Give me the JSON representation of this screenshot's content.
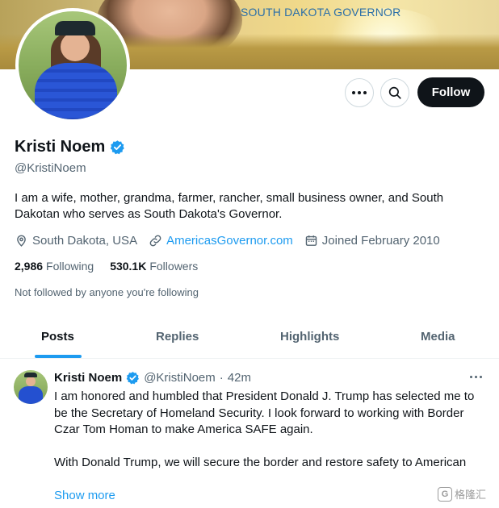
{
  "banner": {
    "title": "SOUTH DAKOTA GOVERNOR"
  },
  "profile": {
    "name": "Kristi Noem",
    "handle": "@KristiNoem",
    "bio": "I am a wife, mother, grandma, farmer, rancher, small business owner, and South Dakotan who serves as South Dakota's Governor.",
    "location": "South Dakota, USA",
    "website": "AmericasGovernor.com",
    "joined": "Joined February 2010",
    "following_count": "2,986",
    "following_label": "Following",
    "followers_count": "530.1K",
    "followers_label": "Followers",
    "not_followed": "Not followed by anyone you're following"
  },
  "actions": {
    "follow_label": "Follow"
  },
  "tabs": [
    {
      "label": "Posts",
      "active": true
    },
    {
      "label": "Replies",
      "active": false
    },
    {
      "label": "Highlights",
      "active": false
    },
    {
      "label": "Media",
      "active": false
    }
  ],
  "tweet": {
    "name": "Kristi Noem",
    "handle": "@KristiNoem",
    "separator": "·",
    "time": "42m",
    "paragraph1": "I am honored and humbled that President Donald J. Trump has selected me to be the Secretary of Homeland Security. I look forward to working with Border Czar Tom Homan to make America SAFE again.",
    "paragraph2": "With Donald Trump, we will secure the border and restore safety to American",
    "show_more": "Show more"
  },
  "watermark": {
    "text": "格隆汇",
    "logo_letter": "G"
  },
  "colors": {
    "accent": "#1d9bf0",
    "text": "#0f1419",
    "muted": "#536471",
    "follow_bg": "#0f1419"
  }
}
